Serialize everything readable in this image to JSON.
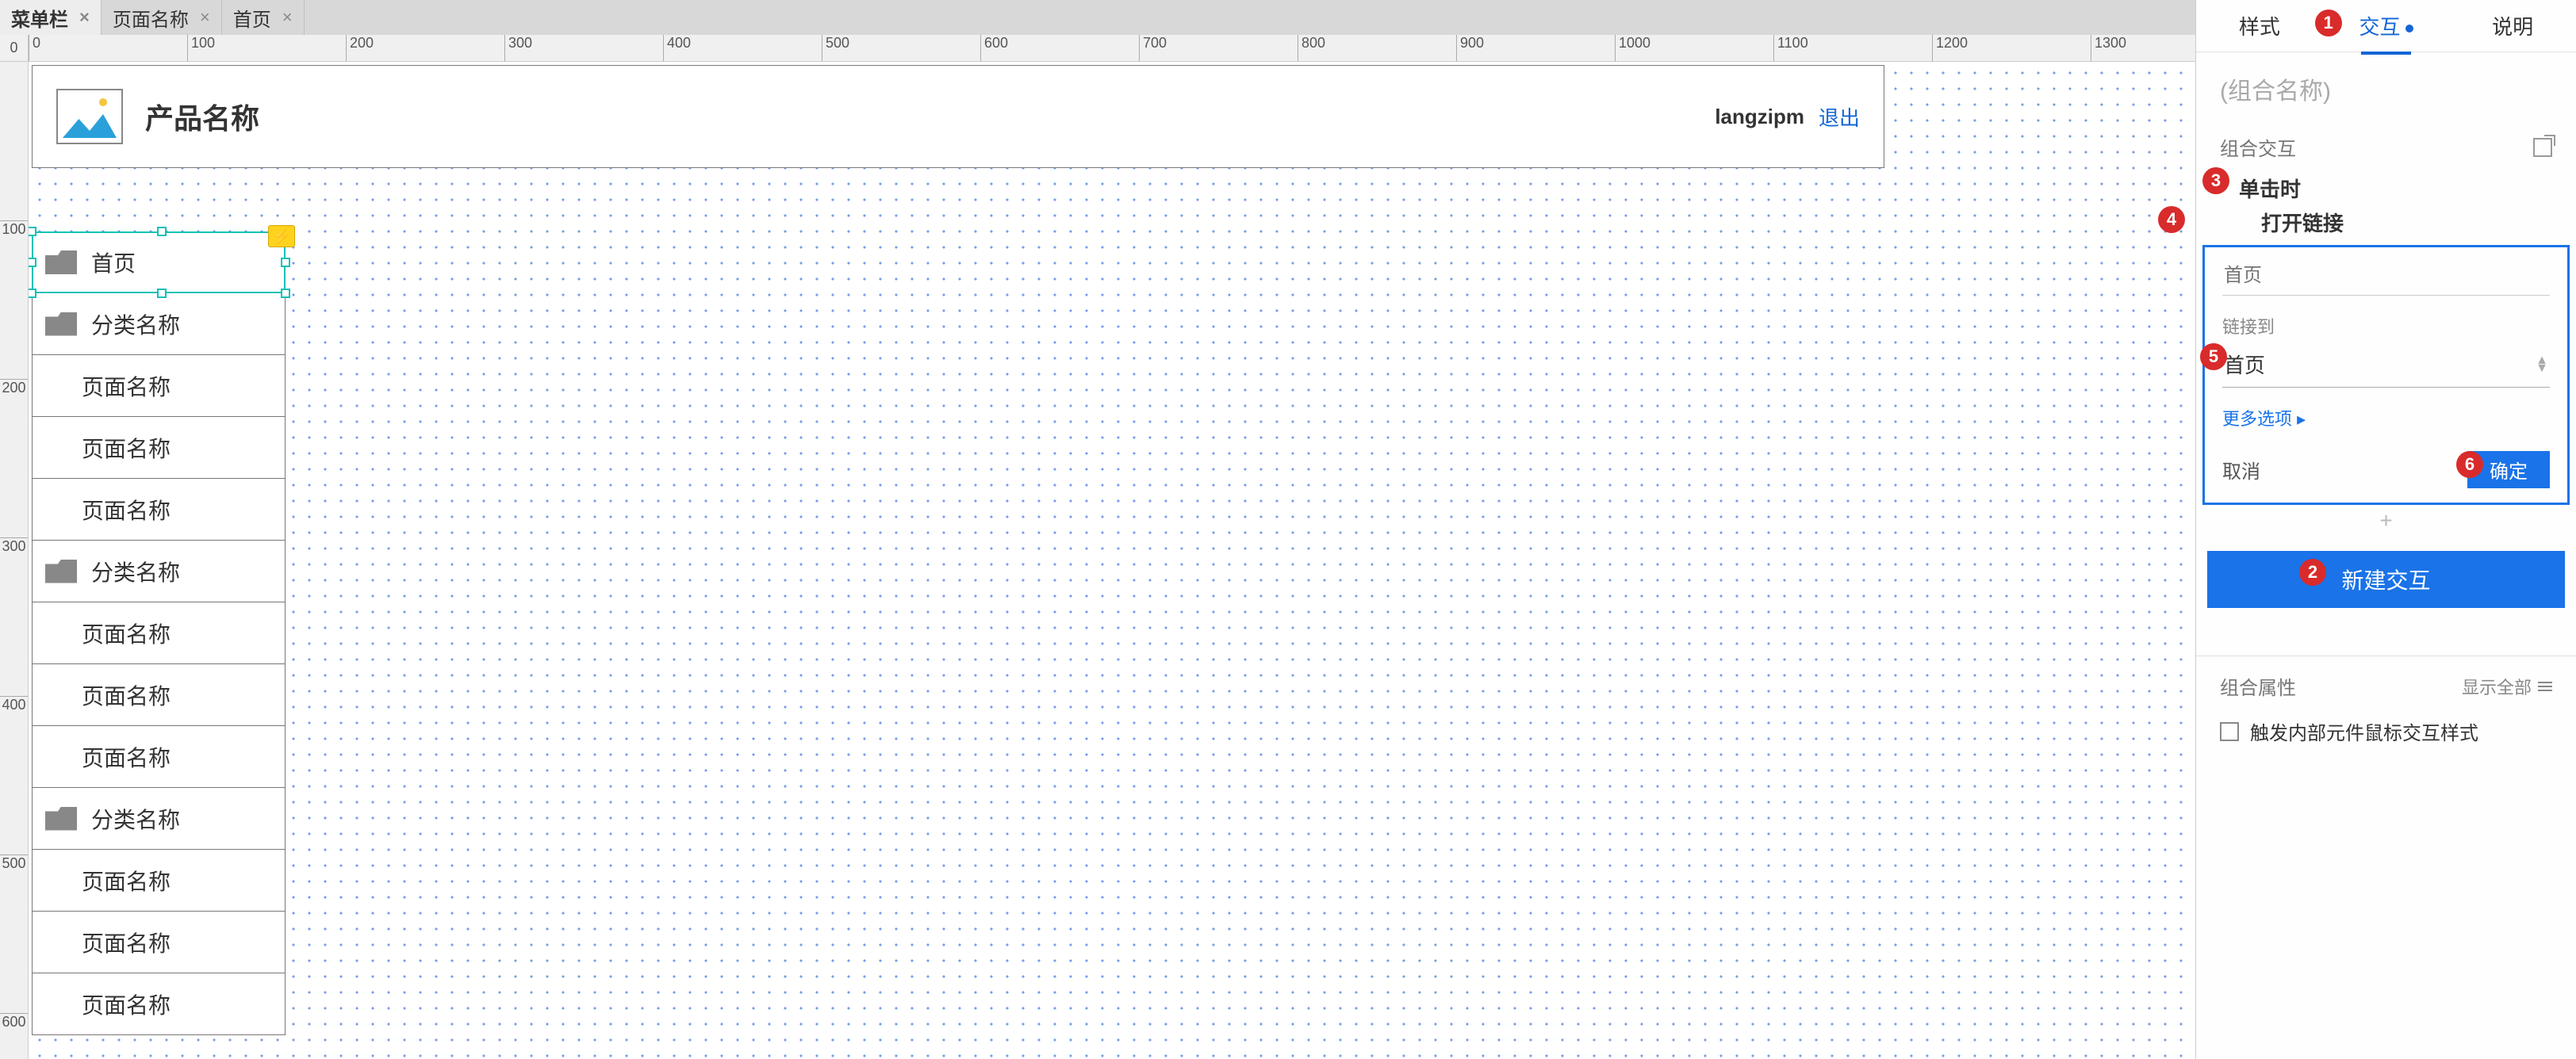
{
  "tabs": [
    {
      "label": "菜单栏",
      "active": true
    },
    {
      "label": "页面名称",
      "active": false
    },
    {
      "label": "首页",
      "active": false
    }
  ],
  "ruler_corner": "0",
  "ruler_h": [
    0,
    100,
    200,
    300,
    400,
    500,
    600,
    700,
    800,
    900,
    1000,
    1100,
    1200,
    1300
  ],
  "ruler_v": [
    100,
    200,
    300,
    400,
    500,
    600
  ],
  "header": {
    "title": "产品名称",
    "user": "langzipm",
    "logout": "退出"
  },
  "menu": [
    {
      "type": "home",
      "label": "首页"
    },
    {
      "type": "cat",
      "label": "分类名称"
    },
    {
      "type": "sub",
      "label": "页面名称"
    },
    {
      "type": "sub",
      "label": "页面名称"
    },
    {
      "type": "sub",
      "label": "页面名称"
    },
    {
      "type": "cat",
      "label": "分类名称"
    },
    {
      "type": "sub",
      "label": "页面名称"
    },
    {
      "type": "sub",
      "label": "页面名称"
    },
    {
      "type": "sub",
      "label": "页面名称"
    },
    {
      "type": "cat",
      "label": "分类名称"
    },
    {
      "type": "sub",
      "label": "页面名称"
    },
    {
      "type": "sub",
      "label": "页面名称"
    },
    {
      "type": "sub",
      "label": "页面名称"
    }
  ],
  "panel": {
    "tabs": {
      "style": "样式",
      "interact": "交互",
      "notes": "说明"
    },
    "combo_placeholder": "(组合名称)",
    "section_interact": "组合交互",
    "event": "单击时",
    "action": "打开链接",
    "target_placeholder": "首页",
    "linkto_label": "链接到",
    "linkto_value": "首页",
    "more": "更多选项 ▸",
    "cancel": "取消",
    "ok": "确定",
    "new_interaction": "新建交互",
    "props_section": "组合属性",
    "show_all": "显示全部",
    "trigger_inner": "触发内部元件鼠标交互样式"
  },
  "callouts": {
    "1": "1",
    "2": "2",
    "3": "3",
    "4": "4",
    "5": "5",
    "6": "6"
  }
}
